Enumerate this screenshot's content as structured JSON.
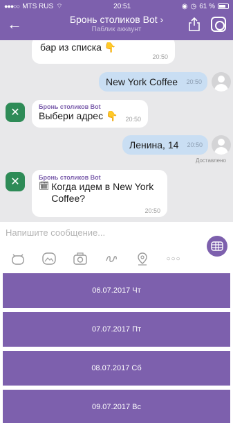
{
  "status_bar": {
    "carrier": "MTS RUS",
    "time": "20:51",
    "battery": "61 %"
  },
  "header": {
    "title": "Бронь столиков Bot ›",
    "subtitle": "Паблик аккаунт"
  },
  "messages": [
    {
      "type": "bot",
      "text": "бар из списка",
      "time": "20:50"
    },
    {
      "type": "user",
      "text": "New York Coffee",
      "time": "20:50"
    },
    {
      "type": "bot",
      "sender": "Бронь столиков Bot",
      "text": "Выбери адрес",
      "time": "20:50"
    },
    {
      "type": "user",
      "text": "Ленина, 14",
      "time": "20:50",
      "status": "Доставлено"
    },
    {
      "type": "bot",
      "sender": "Бронь столиков Bot",
      "text": "Когда идем в New York Coffee?",
      "time": "20:50"
    }
  ],
  "composer": {
    "placeholder": "Напишите сообщение..."
  },
  "keyboard_buttons": [
    "06.07.2017 Чт",
    "07.07.2017 Пт",
    "08.07.2017 Сб",
    "09.07.2017 Вс"
  ],
  "colors": {
    "brand": "#7d60ad",
    "chat_background": "#e8e8ea",
    "user_bubble": "#c9def3",
    "bot_avatar": "#2e8b57"
  }
}
